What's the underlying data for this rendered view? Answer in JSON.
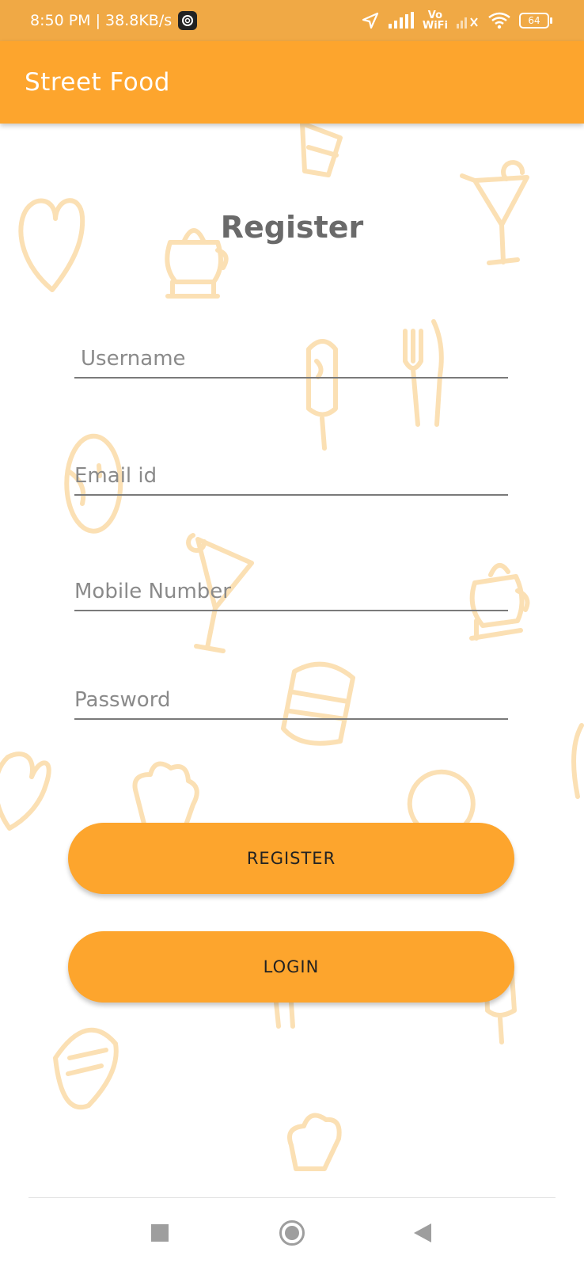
{
  "status_bar": {
    "time_speed": "8:50 PM | 38.8KB/s",
    "volte_label_top": "Vo",
    "volte_label_bottom": "WiFi",
    "battery": "64"
  },
  "app_bar": {
    "title": "Street Food"
  },
  "form": {
    "heading": "Register",
    "username_placeholder": "Username",
    "email_placeholder": "Email id",
    "mobile_placeholder": "Mobile Number",
    "password_placeholder": "Password"
  },
  "buttons": {
    "register_label": "REGISTER",
    "login_label": "LOGIN"
  },
  "colors": {
    "accent": "#fda52d",
    "status_bar": "#f0a945",
    "doodle": "#fbe0b4"
  },
  "nav_bar": {
    "recents_icon": "square-recents-icon",
    "home_icon": "circle-home-icon",
    "back_icon": "triangle-back-icon"
  }
}
